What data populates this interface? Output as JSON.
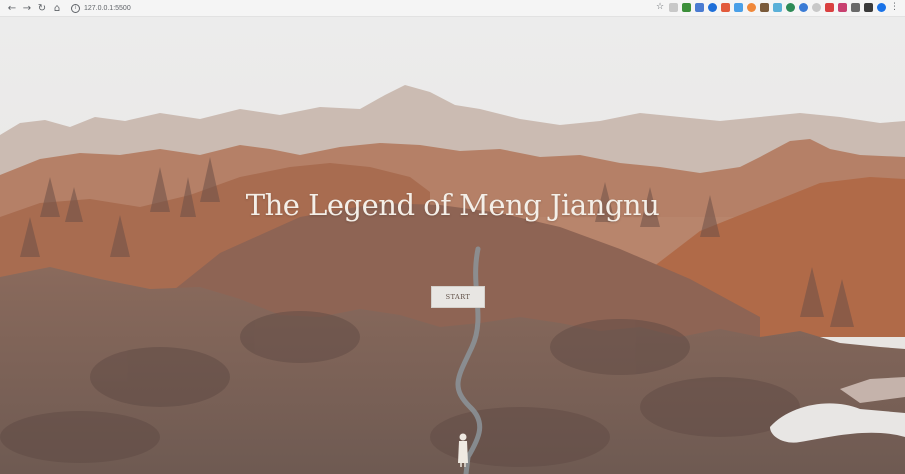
{
  "browser": {
    "back_icon": "back-arrow-icon",
    "forward_icon": "forward-arrow-icon",
    "reload_icon": "reload-icon",
    "home_icon": "home-icon",
    "url": "127.0.0.1:5500",
    "extension_colors": [
      "#c8c8c8",
      "#c8c8c8",
      "#3c8f3a",
      "#4a7bd1",
      "#1e6fd9",
      "#e25a3b",
      "#4aa0e8",
      "#f0883a",
      "#7a5a3a",
      "#5ab0d8",
      "#2e8b57",
      "#d94040",
      "#3a7bd5",
      "#c84070",
      "#6a6a6a",
      "#3a3a3a",
      "#1a73e8"
    ]
  },
  "page": {
    "title": "The Legend of Meng Jiangnu",
    "start_label": "START"
  }
}
